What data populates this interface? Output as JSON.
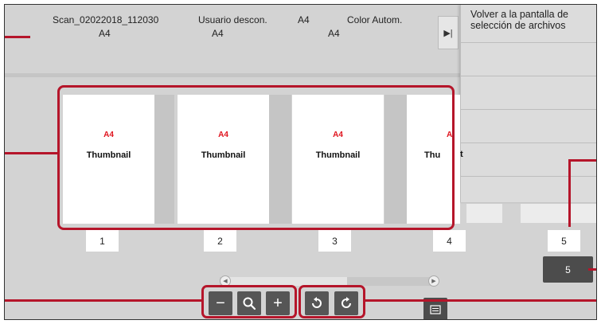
{
  "file_info": {
    "name": "Scan_02022018_112030",
    "user": "Usuario descon.",
    "size": "A4",
    "color": "Color Autom."
  },
  "original_sizes": [
    "A4",
    "A4",
    "A4"
  ],
  "side_panel": {
    "collapse_icon": "▶|",
    "items": [
      "Volver a la pantalla de selección de archivos"
    ]
  },
  "thumbnails": [
    {
      "size": "A4",
      "label": "Thumbnail"
    },
    {
      "size": "A4",
      "label": "Thumbnail"
    },
    {
      "size": "A4",
      "label": "Thumbnail"
    },
    {
      "size": "A",
      "label": "Thu"
    }
  ],
  "page_numbers": [
    "1",
    "2",
    "3",
    "4",
    "5"
  ],
  "total_pages": "5",
  "zoom_toolbar": {
    "zoom_out": "−",
    "zoom": "search-icon",
    "zoom_in": "+"
  },
  "rotate_toolbar": {
    "left": "rotate-left-icon",
    "right": "rotate-right-icon"
  },
  "colors": {
    "highlight": "#b5152a",
    "size_text": "#e0141e",
    "button": "#565656",
    "background": "#d3d3d3"
  }
}
